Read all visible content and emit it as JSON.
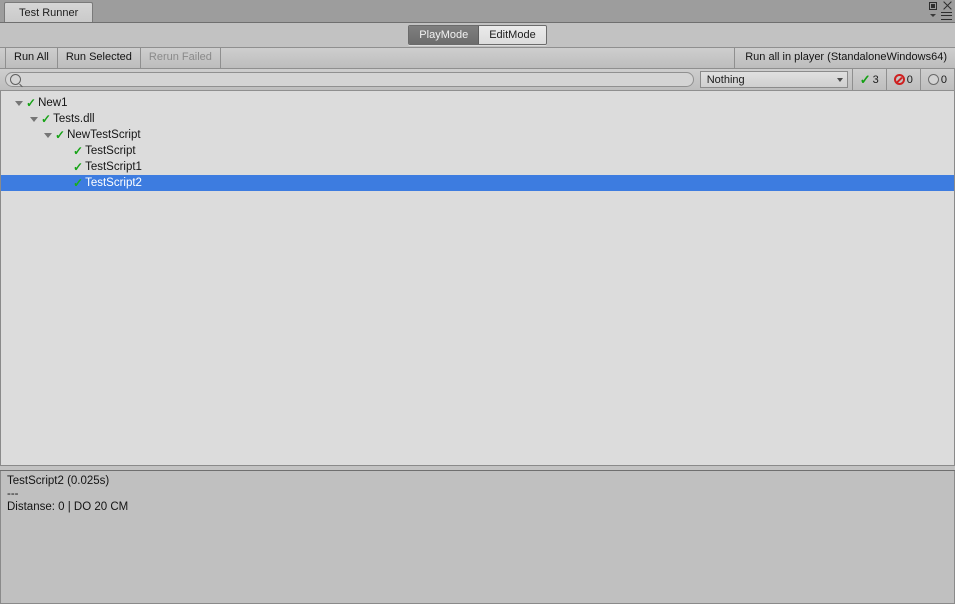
{
  "window": {
    "tab_title": "Test Runner",
    "controls": {
      "maximize": "maximize-icon",
      "close": "close-icon",
      "menu": "hamburger-menu-icon",
      "menu_triangle": "chevron-down-icon"
    }
  },
  "modes": {
    "play_label": "PlayMode",
    "edit_label": "EditMode",
    "selected": "PlayMode"
  },
  "toolbar": {
    "run_all": "Run All",
    "run_selected": "Run Selected",
    "rerun_failed": "Rerun Failed",
    "rerun_failed_disabled": true,
    "run_in_player": "Run all in player (StandaloneWindows64)"
  },
  "filter": {
    "search_value": "",
    "search_placeholder": "",
    "search_icon": "search-icon",
    "dropdown_value": "Nothing",
    "counters": [
      {
        "icon": "check-icon",
        "value": "3",
        "name": "passed-count"
      },
      {
        "icon": "failed-icon",
        "value": "0",
        "name": "failed-count"
      },
      {
        "icon": "skipped-icon",
        "value": "0",
        "name": "skipped-count"
      }
    ]
  },
  "tree": {
    "rows": [
      {
        "label": "New1",
        "depth": 0,
        "expandable": true,
        "status": "passed",
        "selected": false
      },
      {
        "label": "Tests.dll",
        "depth": 1,
        "expandable": true,
        "status": "passed",
        "selected": false
      },
      {
        "label": "NewTestScript",
        "depth": 2,
        "expandable": true,
        "status": "passed",
        "selected": false
      },
      {
        "label": "TestScript",
        "depth": 3,
        "expandable": false,
        "status": "passed",
        "selected": false
      },
      {
        "label": "TestScript1",
        "depth": 3,
        "expandable": false,
        "status": "passed",
        "selected": false
      },
      {
        "label": "TestScript2",
        "depth": 3,
        "expandable": false,
        "status": "passed",
        "selected": true
      }
    ]
  },
  "detail": {
    "lines": [
      "TestScript2 (0.025s)",
      "---",
      "Distanse: 0 | DO 20 CM"
    ]
  },
  "colors": {
    "selection_blue": "#3d7ce0",
    "pass_green": "#17a317",
    "fail_red": "#cf2020",
    "tree_bg": "#dcdcdc",
    "detail_bg": "#c0c0c0",
    "chrome_bg": "#c2c2c2"
  }
}
